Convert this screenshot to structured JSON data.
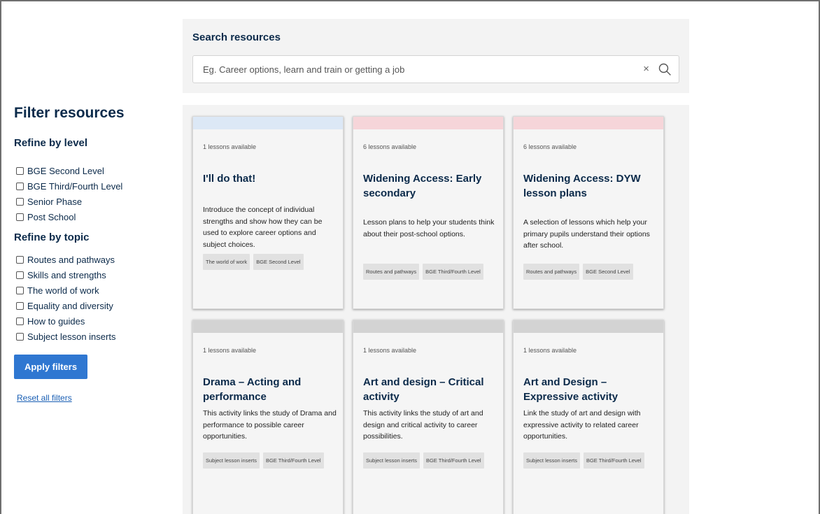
{
  "search": {
    "title": "Search resources",
    "placeholder": "Eg. Career options, learn and train or getting a job",
    "value": "",
    "clear_label": "×"
  },
  "sidebar": {
    "title": "Filter resources",
    "level_heading": "Refine by level",
    "levels": [
      "BGE Second Level",
      "BGE Third/Fourth Level",
      "Senior Phase",
      "Post School"
    ],
    "topic_heading": "Refine by topic",
    "topics": [
      "Routes and pathways",
      "Skills and strengths",
      "The world of work",
      "Equality and diversity",
      "How to guides",
      "Subject lesson inserts"
    ],
    "apply_label": "Apply filters",
    "reset_label": "Reset all filters"
  },
  "cards": [
    {
      "count": "1 lessons available",
      "title": "I'll do that!",
      "desc": "Introduce the concept of individual strengths and show how they can be used to explore career options and subject choices.",
      "tags": [
        "The world of work",
        "BGE Second Level"
      ],
      "accent": "#dce8f6"
    },
    {
      "count": "6 lessons available",
      "title": "Widening Access: Early secondary",
      "desc": "Lesson plans to help your students think about their post-school options.",
      "tags": [
        "Routes and pathways",
        "BGE Third/Fourth Level"
      ],
      "accent": "#f6d5d9"
    },
    {
      "count": "6 lessons available",
      "title": "Widening Access: DYW lesson plans",
      "desc": "A selection of lessons which help your primary pupils understand their options after school.",
      "tags": [
        "Routes and pathways",
        "BGE Second Level"
      ],
      "accent": "#f6d5d9"
    },
    {
      "count": "1 lessons available",
      "title": "Drama – Acting and performance",
      "desc": "This activity links the study of Drama and performance to possible career opportunities.",
      "tags": [
        "Subject lesson inserts",
        "BGE Third/Fourth Level"
      ],
      "accent": "#d3d3d3"
    },
    {
      "count": "1 lessons available",
      "title": "Art and design – Critical activity",
      "desc": "This activity links the study of art and design and critical activity to career possibilities.",
      "tags": [
        "Subject lesson inserts",
        "BGE Third/Fourth Level"
      ],
      "accent": "#d3d3d3"
    },
    {
      "count": "1 lessons available",
      "title": "Art and Design – Expressive activity",
      "desc": "Link the study of art and design with expressive activity to related career opportunities.",
      "tags": [
        "Subject lesson inserts",
        "BGE Third/Fourth Level"
      ],
      "accent": "#d3d3d3"
    }
  ]
}
